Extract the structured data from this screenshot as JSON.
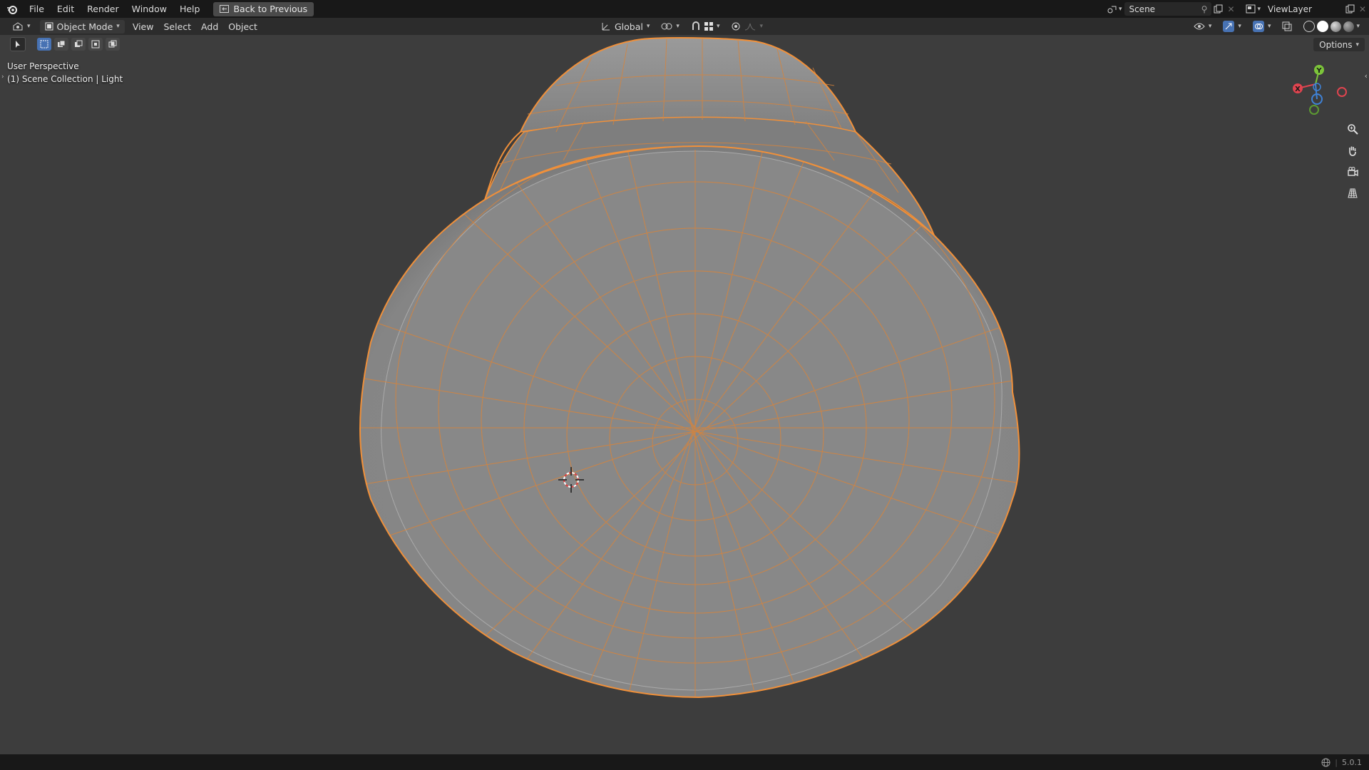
{
  "topbar": {
    "menus": [
      "File",
      "Edit",
      "Render",
      "Window",
      "Help"
    ],
    "back_label": "Back to Previous",
    "scene_name": "Scene",
    "view_layer": "ViewLayer"
  },
  "header": {
    "mode_label": "Object Mode",
    "menus": [
      "View",
      "Select",
      "Add",
      "Object"
    ],
    "orientation": "Global",
    "options_label": "Options"
  },
  "viewport": {
    "perspective_label": "User Perspective",
    "collection_label": "(1) Scene Collection | Light",
    "gizmo": {
      "x_label": "X",
      "y_label": "Y"
    },
    "selection_color": "#f0903a",
    "mesh_color": "#8a8a8a"
  },
  "status": {
    "version": "5.0.1"
  },
  "icons": [
    "blender-logo",
    "back-icon",
    "scene-icon",
    "pin-icon",
    "new-scene-icon",
    "close-icon",
    "viewlayer-icon",
    "editor-type-icon",
    "mode-icon",
    "orientation-icon",
    "pivot-icon",
    "snap-icon",
    "proportional-icon",
    "visibility-icon",
    "gizmo-icon",
    "overlay-icon",
    "xray-icon",
    "zoom-icon",
    "pan-icon",
    "camera-icon",
    "ortho-grid-icon",
    "globe-icon"
  ]
}
